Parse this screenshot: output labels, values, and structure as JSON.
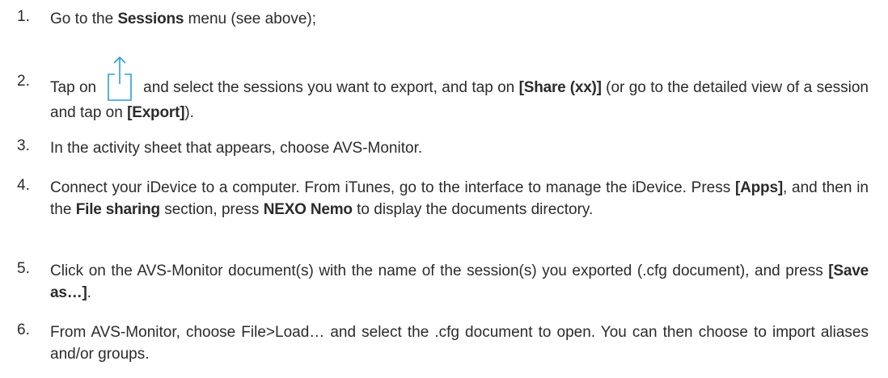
{
  "steps": [
    {
      "num": "1.",
      "parts": [
        {
          "t": "Go to the "
        },
        {
          "t": "Sessions",
          "b": true
        },
        {
          "t": " menu (see above);"
        }
      ]
    },
    {
      "num": "2.",
      "pre": "Tap on",
      "icon": "share-icon",
      "post1": "and select the sessions you want to export, and tap on ",
      "b1": "[Share (xx)]",
      "post2": "  (or go to the detailed view of a session and tap on ",
      "b2": "[Export]",
      "post3": ")."
    },
    {
      "num": "3.",
      "text": "In the activity sheet that appears, choose AVS-Monitor."
    },
    {
      "num": "4.",
      "a": "Connect your iDevice to a computer. From iTunes, go to the interface to manage the iDevice. Press ",
      "b1": "[Apps]",
      "c": ", and then in the ",
      "b2": "File sharing",
      "d": " section, press ",
      "b3": "NEXO Nemo",
      "e": " to display the documents directory."
    },
    {
      "num": "5.",
      "a": "Click on the AVS-Monitor document(s) with the name of the session(s) you exported (.cfg document), and press ",
      "b1": "[Save as…]",
      "c": "."
    },
    {
      "num": "6.",
      "text": "From AVS-Monitor, choose File>Load… and select the .cfg document to open. You can then choose to import aliases and/or groups."
    }
  ]
}
